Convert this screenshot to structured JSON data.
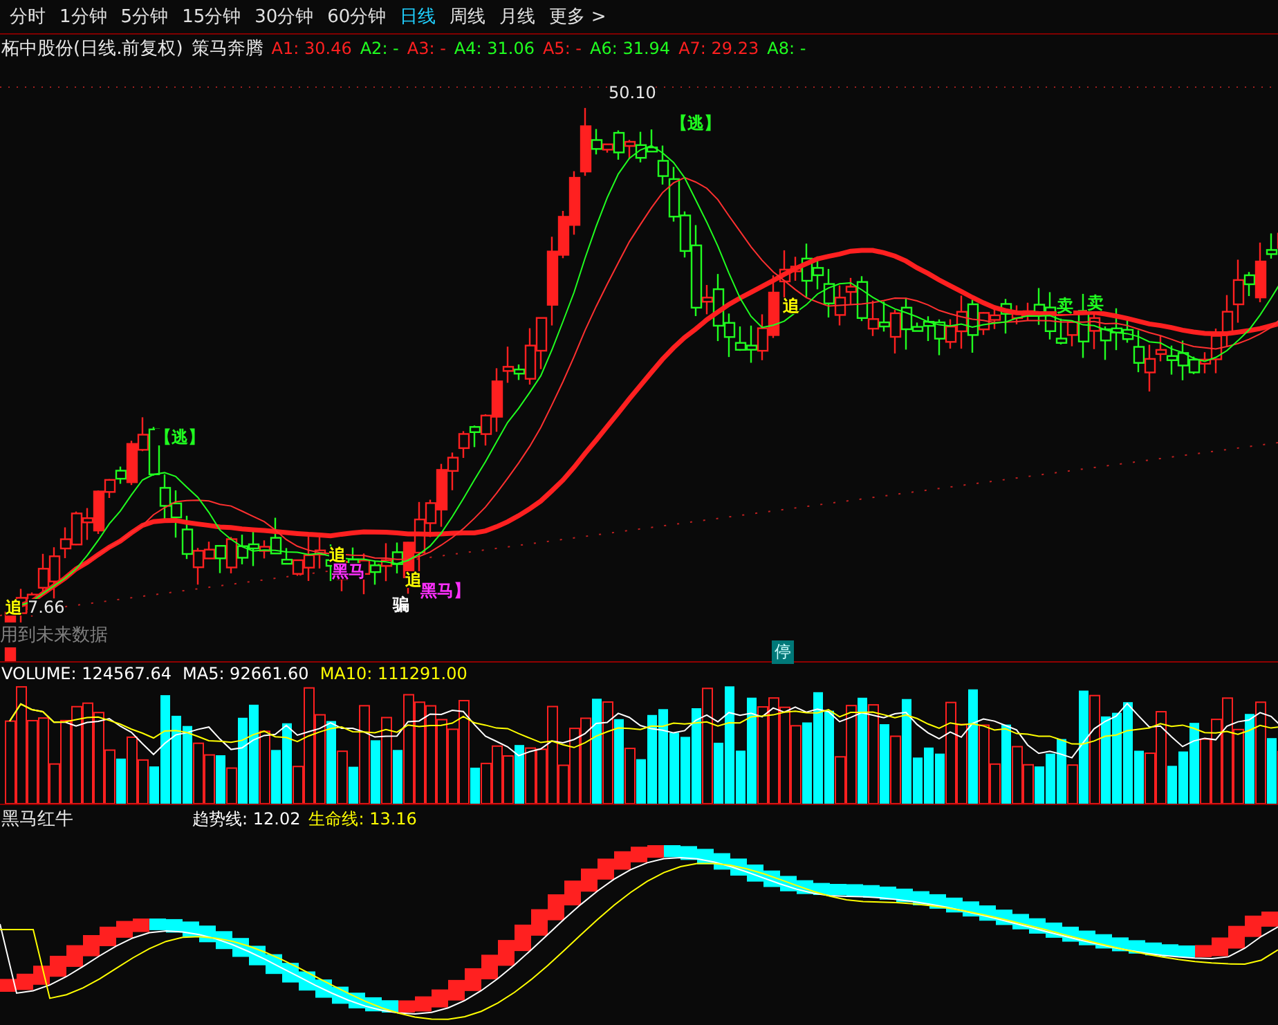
{
  "period_tabs": [
    {
      "label": "分时",
      "selected": false
    },
    {
      "label": "1分钟",
      "selected": false
    },
    {
      "label": "5分钟",
      "selected": false
    },
    {
      "label": "15分钟",
      "selected": false
    },
    {
      "label": "30分钟",
      "selected": false
    },
    {
      "label": "60分钟",
      "selected": false
    },
    {
      "label": "日线",
      "selected": true
    },
    {
      "label": "周线",
      "selected": false
    },
    {
      "label": "月线",
      "selected": false
    },
    {
      "label": "更多 >",
      "selected": false
    }
  ],
  "title": {
    "stock": "柘中股份(日线.前复权)",
    "formula": "策马奔腾"
  },
  "indicators": [
    {
      "label": "A1:",
      "value": "30.46",
      "color": "#ff2020"
    },
    {
      "label": "A2:",
      "value": "-",
      "color": "#20ff20"
    },
    {
      "label": "A3:",
      "value": "-",
      "color": "#ff2020"
    },
    {
      "label": "A4:",
      "value": "31.06",
      "color": "#20ff20"
    },
    {
      "label": "A5:",
      "value": "-",
      "color": "#ff2020"
    },
    {
      "label": "A6:",
      "value": "31.94",
      "color": "#20ff20"
    },
    {
      "label": "A7:",
      "value": "29.23",
      "color": "#ff2020"
    },
    {
      "label": "A8:",
      "value": "-",
      "color": "#20ff20"
    }
  ],
  "price_chart": {
    "high_label": "50.10",
    "low_label": "7.66",
    "notice": "用到未来数据",
    "halt_badge": "停",
    "annotations": [
      {
        "text": "【逃】",
        "color": "#20ff20"
      },
      {
        "text": "【逃】",
        "color": "#20ff20"
      },
      {
        "text": "追",
        "color": "#ffff00"
      },
      {
        "text": "追",
        "color": "#ffff00"
      },
      {
        "text": "黑马",
        "color": "#ff30ff"
      },
      {
        "text": "追",
        "color": "#ffff00"
      },
      {
        "text": "黑马】",
        "color": "#ff30ff"
      },
      {
        "text": "骗",
        "color": "#ffffff"
      },
      {
        "text": "卖",
        "color": "#20ff20"
      },
      {
        "text": "卖",
        "color": "#20ff20"
      },
      {
        "text": "追",
        "color": "#ffff00"
      }
    ]
  },
  "volume": {
    "items": [
      {
        "label": "VOLUME:",
        "value": "124567.64",
        "color": "#ffffff"
      },
      {
        "label": "MA5:",
        "value": "92661.60",
        "color": "#ffffff"
      },
      {
        "label": "MA10:",
        "value": "111291.00",
        "color": "#ffff00"
      }
    ]
  },
  "indicator": {
    "name": "黑马红牛",
    "lines": [
      {
        "label": "趋势线:",
        "value": "12.02",
        "color": "#ffffff"
      },
      {
        "label": "生命线:",
        "value": "13.16",
        "color": "#ffff00"
      }
    ]
  }
}
